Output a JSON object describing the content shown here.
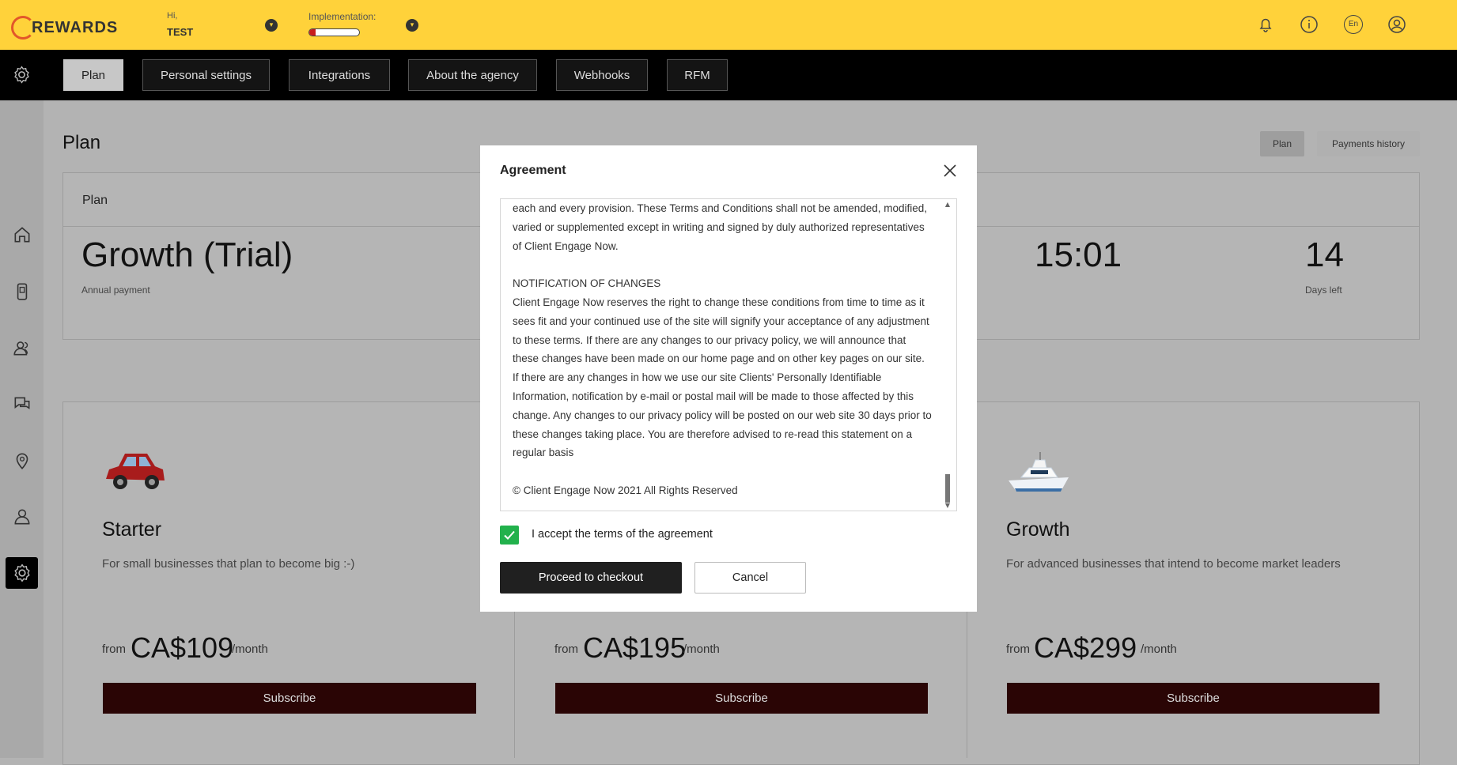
{
  "header": {
    "logo_text": "REWARDS",
    "greeting": "Hi,",
    "user_name": "TEST",
    "implementation_label": "Implementation:",
    "implementation_progress": 0.12,
    "icons": [
      "bell-icon",
      "info-icon",
      "language-icon",
      "user-icon"
    ],
    "language": "En"
  },
  "nav": {
    "tabs": [
      {
        "label": "Plan",
        "active": true
      },
      {
        "label": "Personal settings",
        "active": false
      },
      {
        "label": "Integrations",
        "active": false
      },
      {
        "label": "About the agency",
        "active": false
      },
      {
        "label": "Webhooks",
        "active": false
      },
      {
        "label": "RFM",
        "active": false
      }
    ]
  },
  "page": {
    "title": "Plan",
    "pills": [
      {
        "label": "Plan"
      },
      {
        "label": "Payments history"
      }
    ]
  },
  "current_plan": {
    "card_title": "Plan",
    "name": "Growth (Trial)",
    "payment": "Annual payment",
    "time": "15:01",
    "days": "14",
    "days_label": "Days left"
  },
  "plans": [
    {
      "name": "Starter",
      "desc": "For small businesses that plan to become big :-)",
      "from": "from",
      "price": "CA$109",
      "per": "/month",
      "button": "Subscribe"
    },
    {
      "name": "",
      "desc": "",
      "from": "from",
      "price": "CA$195",
      "per": "/month",
      "button": "Subscribe"
    },
    {
      "name": "Growth",
      "desc": "For advanced businesses that intend to become market leaders",
      "from": "from",
      "price": "CA$299",
      "per": "/month",
      "button": "Subscribe"
    }
  ],
  "modal": {
    "title": "Agreement",
    "terms": {
      "p1": "each and every provision. These Terms and Conditions shall not be amended, modified, varied or supplemented except in writing and signed by duly authorized representatives of Client Engage Now.",
      "heading": "NOTIFICATION OF CHANGES",
      "p2": "Client Engage Now reserves the right to change these conditions from time to time as it sees fit and your continued use of the site will signify your acceptance of any adjustment to these terms. If there are any changes to our privacy policy, we will announce that these changes have been made on our home page and on other key pages on our site. If there are any changes in how we use our site Clients' Personally Identifiable Information, notification by e-mail or postal mail will be made to those affected by this change. Any changes to our privacy policy will be posted on our web site 30 days prior to these changes taking place. You are therefore advised to re-read this statement on a regular basis",
      "copyright": "© Client Engage Now 2021 All Rights Reserved"
    },
    "accept_label": "I accept the terms of the agreement",
    "accepted": true,
    "proceed_label": "Proceed to checkout",
    "cancel_label": "Cancel"
  }
}
